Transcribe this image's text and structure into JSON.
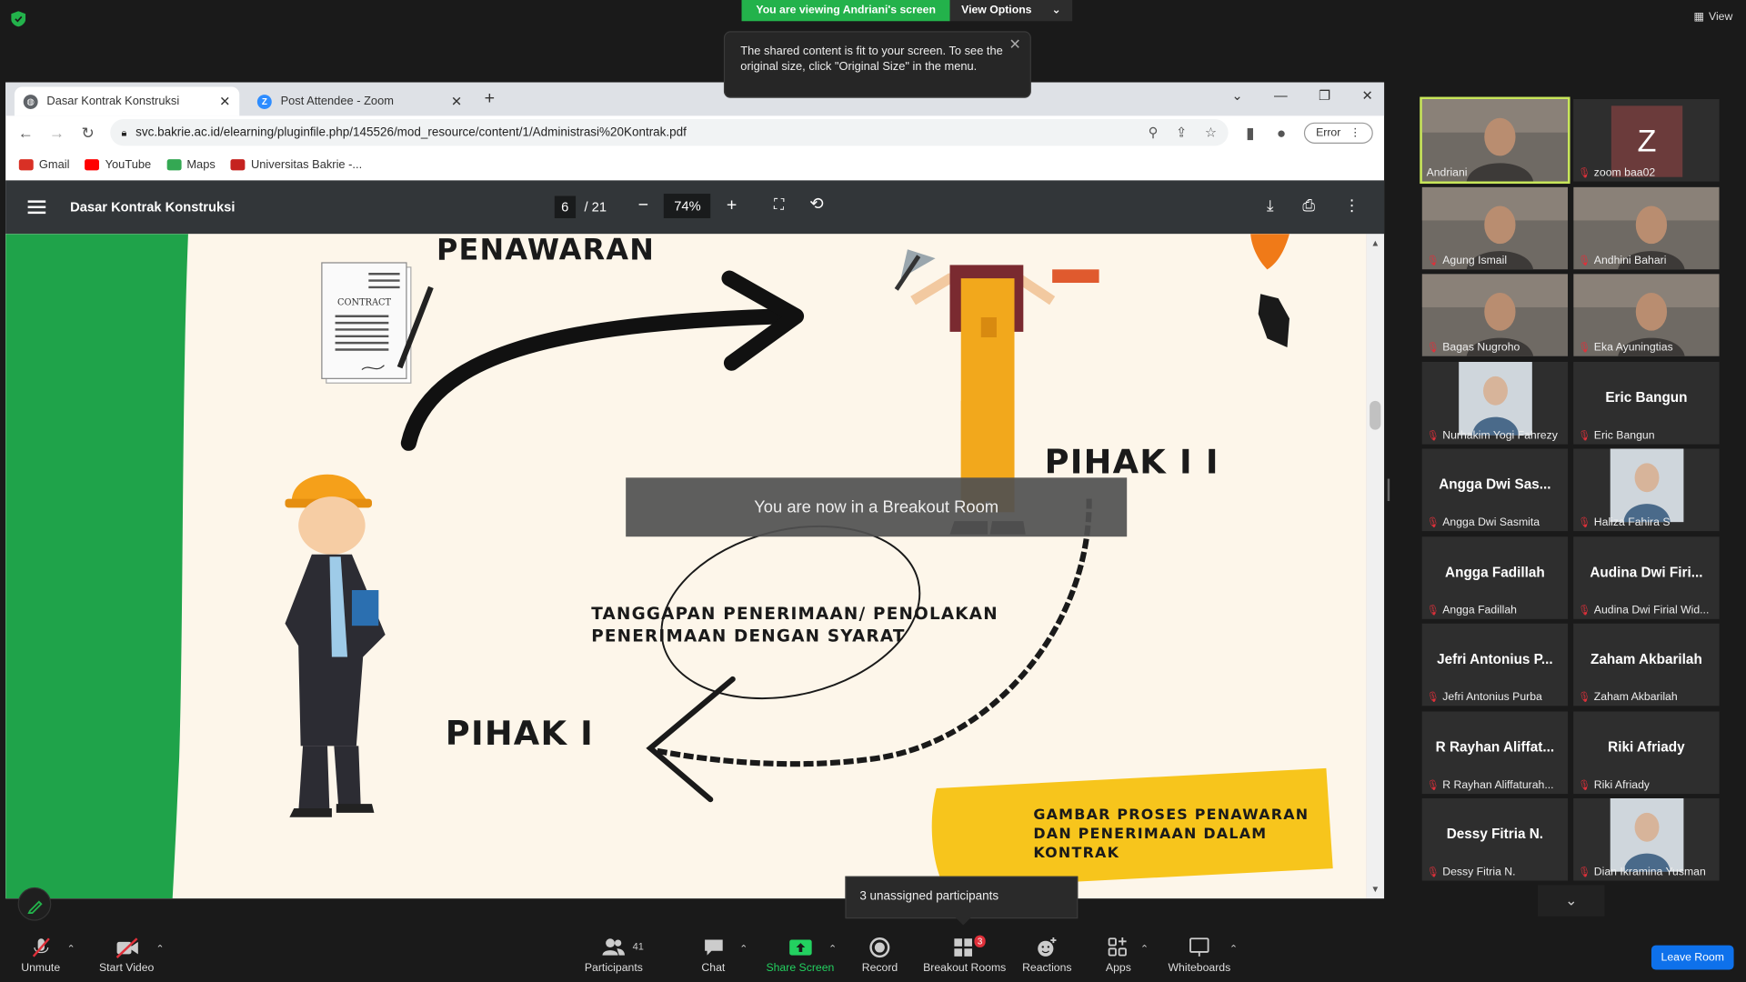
{
  "zoom_top": {
    "viewing_label": "You are viewing Andriani's screen",
    "view_options_label": "View Options",
    "view_label": "View",
    "tooltip_text": "The shared content is fit to your screen. To see the original size, click \"Original Size\" in the menu."
  },
  "browser": {
    "tabs": [
      {
        "label": "Dasar Kontrak Konstruksi",
        "icon": "chrome-globe-icon"
      },
      {
        "label": "Post Attendee - Zoom",
        "icon": "zoom-icon"
      }
    ],
    "url": "svc.bakrie.ac.id/elearning/pluginfile.php/145526/mod_resource/content/1/Administrasi%20Kontrak.pdf",
    "profile_label": "Error",
    "bookmarks": [
      {
        "label": "Gmail",
        "color": "#d93025"
      },
      {
        "label": "YouTube",
        "color": "#ff0000"
      },
      {
        "label": "Maps",
        "color": "#34a853"
      },
      {
        "label": "Universitas Bakrie -...",
        "color": "#c5221f"
      }
    ]
  },
  "pdf": {
    "title": "Dasar Kontrak Konstruksi",
    "current_page": "6",
    "total_pages": "/ 21",
    "zoom": "74%",
    "slide": {
      "penawaran": "PENAWARAN",
      "pihak2": "PIHAK I I",
      "pihak1": "PIHAK I",
      "tanggapan_line1": "TANGGAPAN PENERIMAAN/ PENOLAKAN",
      "tanggapan_line2": "PENERIMAAN DENGAN SYARAT",
      "gambar_line1": "GAMBAR PROSES PENAWARAN",
      "gambar_line2": "DAN PENERIMAAN DALAM",
      "gambar_line3": "KONTRAK",
      "contract_label": "CONTRACT"
    }
  },
  "breakout_banner": "You are now in a Breakout Room",
  "unassigned_text": "3 unassigned participants",
  "participants": [
    {
      "name": "Andriani",
      "big": "",
      "type": "video",
      "muted": false,
      "active": true
    },
    {
      "name": "zoom baa02",
      "big": "",
      "type": "avatar",
      "muted": true,
      "avatar_letter": "Z"
    },
    {
      "name": "Agung Ismail",
      "big": "",
      "type": "video",
      "muted": true
    },
    {
      "name": "Andhini Bahari",
      "big": "",
      "type": "video",
      "muted": true
    },
    {
      "name": "Bagas Nugroho",
      "big": "",
      "type": "video",
      "muted": true
    },
    {
      "name": "Eka Ayuningtias",
      "big": "",
      "type": "video",
      "muted": true
    },
    {
      "name": "Nurhakim Yogi Fahrezy",
      "big": "",
      "type": "photo",
      "muted": true
    },
    {
      "name": "Eric Bangun",
      "big": "Eric Bangun",
      "type": "name",
      "muted": true
    },
    {
      "name": "Angga Dwi Sasmita",
      "big": "Angga Dwi Sas...",
      "type": "name",
      "muted": true
    },
    {
      "name": "Haliza Fahira S",
      "big": "",
      "type": "photo",
      "muted": true
    },
    {
      "name": "Angga Fadillah",
      "big": "Angga Fadillah",
      "type": "name",
      "muted": true
    },
    {
      "name": "Audina Dwi Firial Wid...",
      "big": "Audina Dwi Firi...",
      "type": "name",
      "muted": true
    },
    {
      "name": "Jefri Antonius Purba",
      "big": "Jefri Antonius P...",
      "type": "name",
      "muted": true
    },
    {
      "name": "Zaham Akbarilah",
      "big": "Zaham Akbarilah",
      "type": "name",
      "muted": true
    },
    {
      "name": "R Rayhan Aliffaturah...",
      "big": "R Rayhan Aliffat...",
      "type": "name",
      "muted": true
    },
    {
      "name": "Riki Afriady",
      "big": "Riki Afriady",
      "type": "name",
      "muted": true
    },
    {
      "name": "Dessy Fitria N.",
      "big": "Dessy Fitria N.",
      "type": "name",
      "muted": true
    },
    {
      "name": "Dian Ikramina Yusman",
      "big": "",
      "type": "photo",
      "muted": true
    }
  ],
  "toolbar": {
    "unmute": "Unmute",
    "start_video": "Start Video",
    "participants": "Participants",
    "participants_count": "41",
    "chat": "Chat",
    "share_screen": "Share Screen",
    "record": "Record",
    "breakout_rooms": "Breakout Rooms",
    "breakout_badge": "3",
    "reactions": "Reactions",
    "apps": "Apps",
    "whiteboards": "Whiteboards",
    "leave_room": "Leave Room"
  },
  "colors": {
    "zoom_green": "#23b24b",
    "leave_blue": "#0e71eb",
    "slide_green": "#1fa34a",
    "slide_yellow": "#f7c51c",
    "active_speaker": "#c8e65a"
  }
}
